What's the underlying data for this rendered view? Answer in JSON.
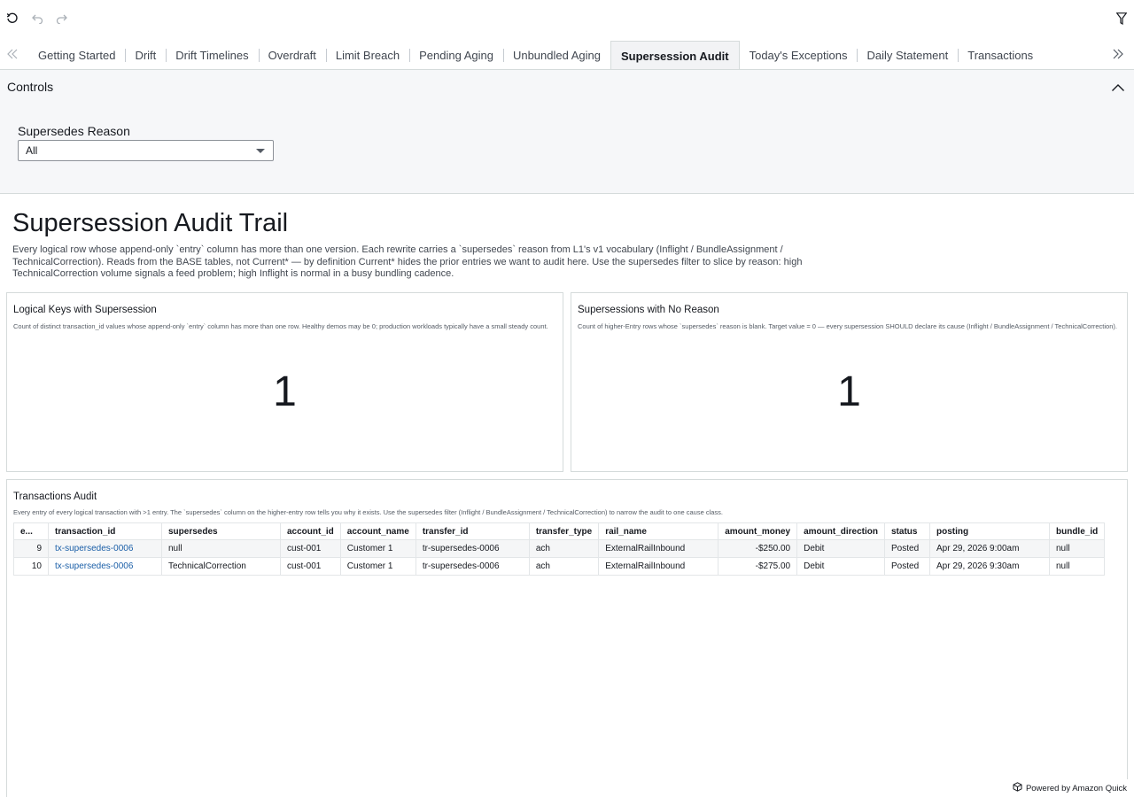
{
  "toolbar": {
    "refresh_icon": "refresh-icon",
    "undo_icon": "undo-icon",
    "redo_icon": "redo-icon",
    "filter_icon": "filter-icon"
  },
  "tabs": [
    {
      "label": "Getting Started",
      "active": false
    },
    {
      "label": "Drift",
      "active": false
    },
    {
      "label": "Drift Timelines",
      "active": false
    },
    {
      "label": "Overdraft",
      "active": false
    },
    {
      "label": "Limit Breach",
      "active": false
    },
    {
      "label": "Pending Aging",
      "active": false
    },
    {
      "label": "Unbundled Aging",
      "active": false
    },
    {
      "label": "Supersession Audit",
      "active": true
    },
    {
      "label": "Today's Exceptions",
      "active": false
    },
    {
      "label": "Daily Statement",
      "active": false
    },
    {
      "label": "Transactions",
      "active": false
    }
  ],
  "controls": {
    "title": "Controls",
    "filter_label": "Supersedes Reason",
    "filter_value": "All"
  },
  "sheet": {
    "title": "Supersession Audit Trail",
    "description": "Every logical row whose append-only `entry` column has more than one version. Each rewrite carries a `supersedes` reason from L1's v1 vocabulary (Inflight / BundleAssignment / TechnicalCorrection). Reads from the BASE tables, not Current* — by definition Current* hides the prior entries we want to audit here. Use the supersedes filter to slice by reason: high TechnicalCorrection volume signals a feed problem; high Inflight is normal in a busy bundling cadence."
  },
  "kpi_left": {
    "title": "Logical Keys with Supersession",
    "subtitle": "Count of distinct transaction_id values whose append-only `entry` column has more than one row. Healthy demos may be 0; production workloads typically have a small steady count.",
    "value": "1"
  },
  "kpi_right": {
    "title": "Supersessions with No Reason",
    "subtitle": "Count of higher-Entry rows whose `supersedes` reason is blank. Target value = 0 — every supersession SHOULD declare its cause (Inflight / BundleAssignment / TechnicalCorrection).",
    "value": "1"
  },
  "audit_table": {
    "title": "Transactions Audit",
    "subtitle": "Every entry of every logical transaction with >1 entry. The `supersedes` column on the higher-entry row tells you why it exists. Use the supersedes filter (Inflight / BundleAssignment / TechnicalCorrection) to narrow the audit to one cause class.",
    "columns": [
      "e...",
      "transaction_id",
      "supersedes",
      "account_id",
      "account_name",
      "transfer_id",
      "transfer_type",
      "rail_name",
      "amount_money",
      "amount_direction",
      "status",
      "posting",
      "bundle_id"
    ],
    "rows": [
      [
        "9",
        "tx-supersedes-0006",
        "null",
        "cust-001",
        "Customer 1",
        "tr-supersedes-0006",
        "ach",
        "ExternalRailInbound",
        "-$250.00",
        "Debit",
        "Posted",
        "Apr 29, 2026 9:00am",
        "null"
      ],
      [
        "10",
        "tx-supersedes-0006",
        "TechnicalCorrection",
        "cust-001",
        "Customer 1",
        "tr-supersedes-0006",
        "ach",
        "ExternalRailInbound",
        "-$275.00",
        "Debit",
        "Posted",
        "Apr 29, 2026 9:30am",
        "null"
      ]
    ]
  },
  "footer": {
    "powered_by": "Powered by Amazon Quick"
  }
}
